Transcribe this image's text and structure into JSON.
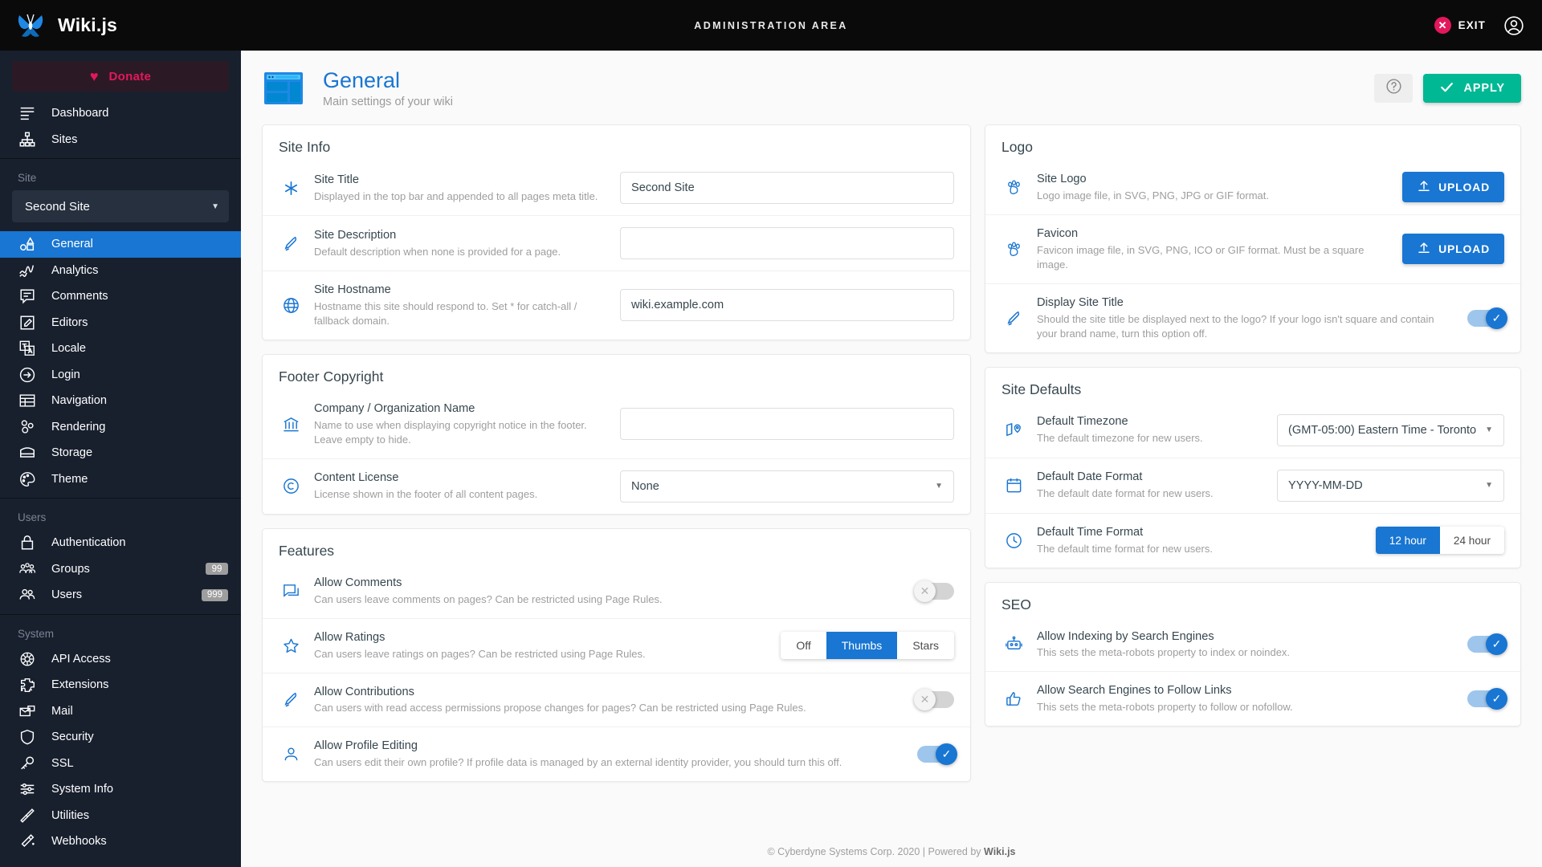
{
  "topbar": {
    "brand": "Wiki.js",
    "center_title": "ADMINISTRATION AREA",
    "exit_label": "EXIT",
    "exit_icon": "close-circle-icon",
    "account_icon": "account-circle-icon",
    "logo_icon": "wikijs-butterfly-logo"
  },
  "sidebar": {
    "donate_label": "Donate",
    "donate_icon": "heart-icon",
    "top_items": [
      {
        "label": "Dashboard",
        "icon": "dashboard-icon"
      },
      {
        "label": "Sites",
        "icon": "sitemap-icon"
      }
    ],
    "site_section_label": "Site",
    "site_selected": "Second Site",
    "site_items": [
      {
        "label": "General",
        "icon": "general-icon",
        "active": true
      },
      {
        "label": "Analytics",
        "icon": "analytics-icon",
        "active": false
      },
      {
        "label": "Comments",
        "icon": "comments-icon",
        "active": false
      },
      {
        "label": "Editors",
        "icon": "editors-icon",
        "active": false
      },
      {
        "label": "Locale",
        "icon": "locale-icon",
        "active": false
      },
      {
        "label": "Login",
        "icon": "login-icon",
        "active": false
      },
      {
        "label": "Navigation",
        "icon": "navigation-icon",
        "active": false
      },
      {
        "label": "Rendering",
        "icon": "rendering-icon",
        "active": false
      },
      {
        "label": "Storage",
        "icon": "storage-icon",
        "active": false
      },
      {
        "label": "Theme",
        "icon": "theme-icon",
        "active": false
      }
    ],
    "users_section_label": "Users",
    "users_items": [
      {
        "label": "Authentication",
        "icon": "lock-icon",
        "badge": ""
      },
      {
        "label": "Groups",
        "icon": "groups-icon",
        "badge": "99"
      },
      {
        "label": "Users",
        "icon": "users-icon",
        "badge": "999"
      }
    ],
    "system_section_label": "System",
    "system_items": [
      {
        "label": "API Access",
        "icon": "api-icon"
      },
      {
        "label": "Extensions",
        "icon": "extensions-icon"
      },
      {
        "label": "Mail",
        "icon": "mail-icon"
      },
      {
        "label": "Security",
        "icon": "shield-icon"
      },
      {
        "label": "SSL",
        "icon": "key-icon"
      },
      {
        "label": "System Info",
        "icon": "sliders-icon"
      },
      {
        "label": "Utilities",
        "icon": "screwdriver-icon"
      },
      {
        "label": "Webhooks",
        "icon": "wand-icon"
      }
    ]
  },
  "header": {
    "title": "General",
    "subtitle": "Main settings of your wiki",
    "page_icon": "browser-window-icon",
    "help_icon": "help-circle-icon",
    "apply_label": "APPLY",
    "apply_icon": "check-icon"
  },
  "site_info": {
    "title": "Site Info",
    "rows": [
      {
        "label": "Site Title",
        "desc": "Displayed in the top bar and appended to all pages meta title.",
        "icon": "asterisk-icon",
        "value": "Second Site",
        "placeholder": ""
      },
      {
        "label": "Site Description",
        "desc": "Default description when none is provided for a page.",
        "icon": "pen-icon",
        "value": "",
        "placeholder": ""
      },
      {
        "label": "Site Hostname",
        "desc": "Hostname this site should respond to. Set * for catch-all / fallback domain.",
        "icon": "globe-icon",
        "value": "wiki.example.com",
        "placeholder": ""
      }
    ]
  },
  "footer_copyright": {
    "title": "Footer Copyright",
    "company_label": "Company / Organization Name",
    "company_desc": "Name to use when displaying copyright notice in the footer. Leave empty to hide.",
    "company_icon": "bank-icon",
    "company_value": "",
    "license_label": "Content License",
    "license_desc": "License shown in the footer of all content pages.",
    "license_icon": "copyright-icon",
    "license_value": "None"
  },
  "features": {
    "title": "Features",
    "comments_label": "Allow Comments",
    "comments_desc": "Can users leave comments on pages? Can be restricted using Page Rules.",
    "comments_icon": "comment-icon",
    "comments_on": false,
    "ratings_label": "Allow Ratings",
    "ratings_desc": "Can users leave ratings on pages? Can be restricted using Page Rules.",
    "ratings_icon": "star-icon",
    "ratings_options": [
      "Off",
      "Thumbs",
      "Stars"
    ],
    "ratings_selected": "Thumbs",
    "contributions_label": "Allow Contributions",
    "contributions_desc": "Can users with read access permissions propose changes for pages? Can be restricted using Page Rules.",
    "contributions_icon": "pen-icon",
    "contributions_on": false,
    "profile_label": "Allow Profile Editing",
    "profile_desc": "Can users edit their own profile? If profile data is managed by an external identity provider, you should turn this off.",
    "profile_icon": "account-icon",
    "profile_on": true
  },
  "logo": {
    "title": "Logo",
    "site_logo_label": "Site Logo",
    "site_logo_desc": "Logo image file, in SVG, PNG, JPG or GIF format.",
    "site_logo_icon": "paw-icon",
    "site_logo_button": "UPLOAD",
    "favicon_label": "Favicon",
    "favicon_desc": "Favicon image file, in SVG, PNG, ICO or GIF format. Must be a square image.",
    "favicon_icon": "paw-icon",
    "favicon_button": "UPLOAD",
    "upload_icon": "upload-icon",
    "display_title_label": "Display Site Title",
    "display_title_desc": "Should the site title be displayed next to the logo? If your logo isn't square and contain your brand name, turn this option off.",
    "display_title_icon": "pen-icon",
    "display_title_on": true
  },
  "site_defaults": {
    "title": "Site Defaults",
    "timezone_label": "Default Timezone",
    "timezone_desc": "The default timezone for new users.",
    "timezone_icon": "map-marker-icon",
    "timezone_value": "(GMT-05:00) Eastern Time - Toronto",
    "date_label": "Default Date Format",
    "date_desc": "The default date format for new users.",
    "date_icon": "calendar-icon",
    "date_value": "YYYY-MM-DD",
    "time_label": "Default Time Format",
    "time_desc": "The default time format for new users.",
    "time_icon": "clock-icon",
    "time_options": [
      "12 hour",
      "24 hour"
    ],
    "time_selected": "12 hour"
  },
  "seo": {
    "title": "SEO",
    "indexing_label": "Allow Indexing by Search Engines",
    "indexing_desc": "This sets the meta-robots property to index or noindex.",
    "indexing_icon": "robot-icon",
    "indexing_on": true,
    "follow_label": "Allow Search Engines to Follow Links",
    "follow_desc": "This sets the meta-robots property to follow or nofollow.",
    "follow_icon": "thumbs-up-icon",
    "follow_on": true
  },
  "page_footer": {
    "text": "© Cyberdyne Systems Corp. 2020 | Powered by ",
    "brand": "Wiki.js"
  },
  "colors": {
    "accent_blue": "#1976d2",
    "brand_pink": "#e4175c",
    "apply_green": "#00b894",
    "sidebar_bg": "#18202e"
  }
}
